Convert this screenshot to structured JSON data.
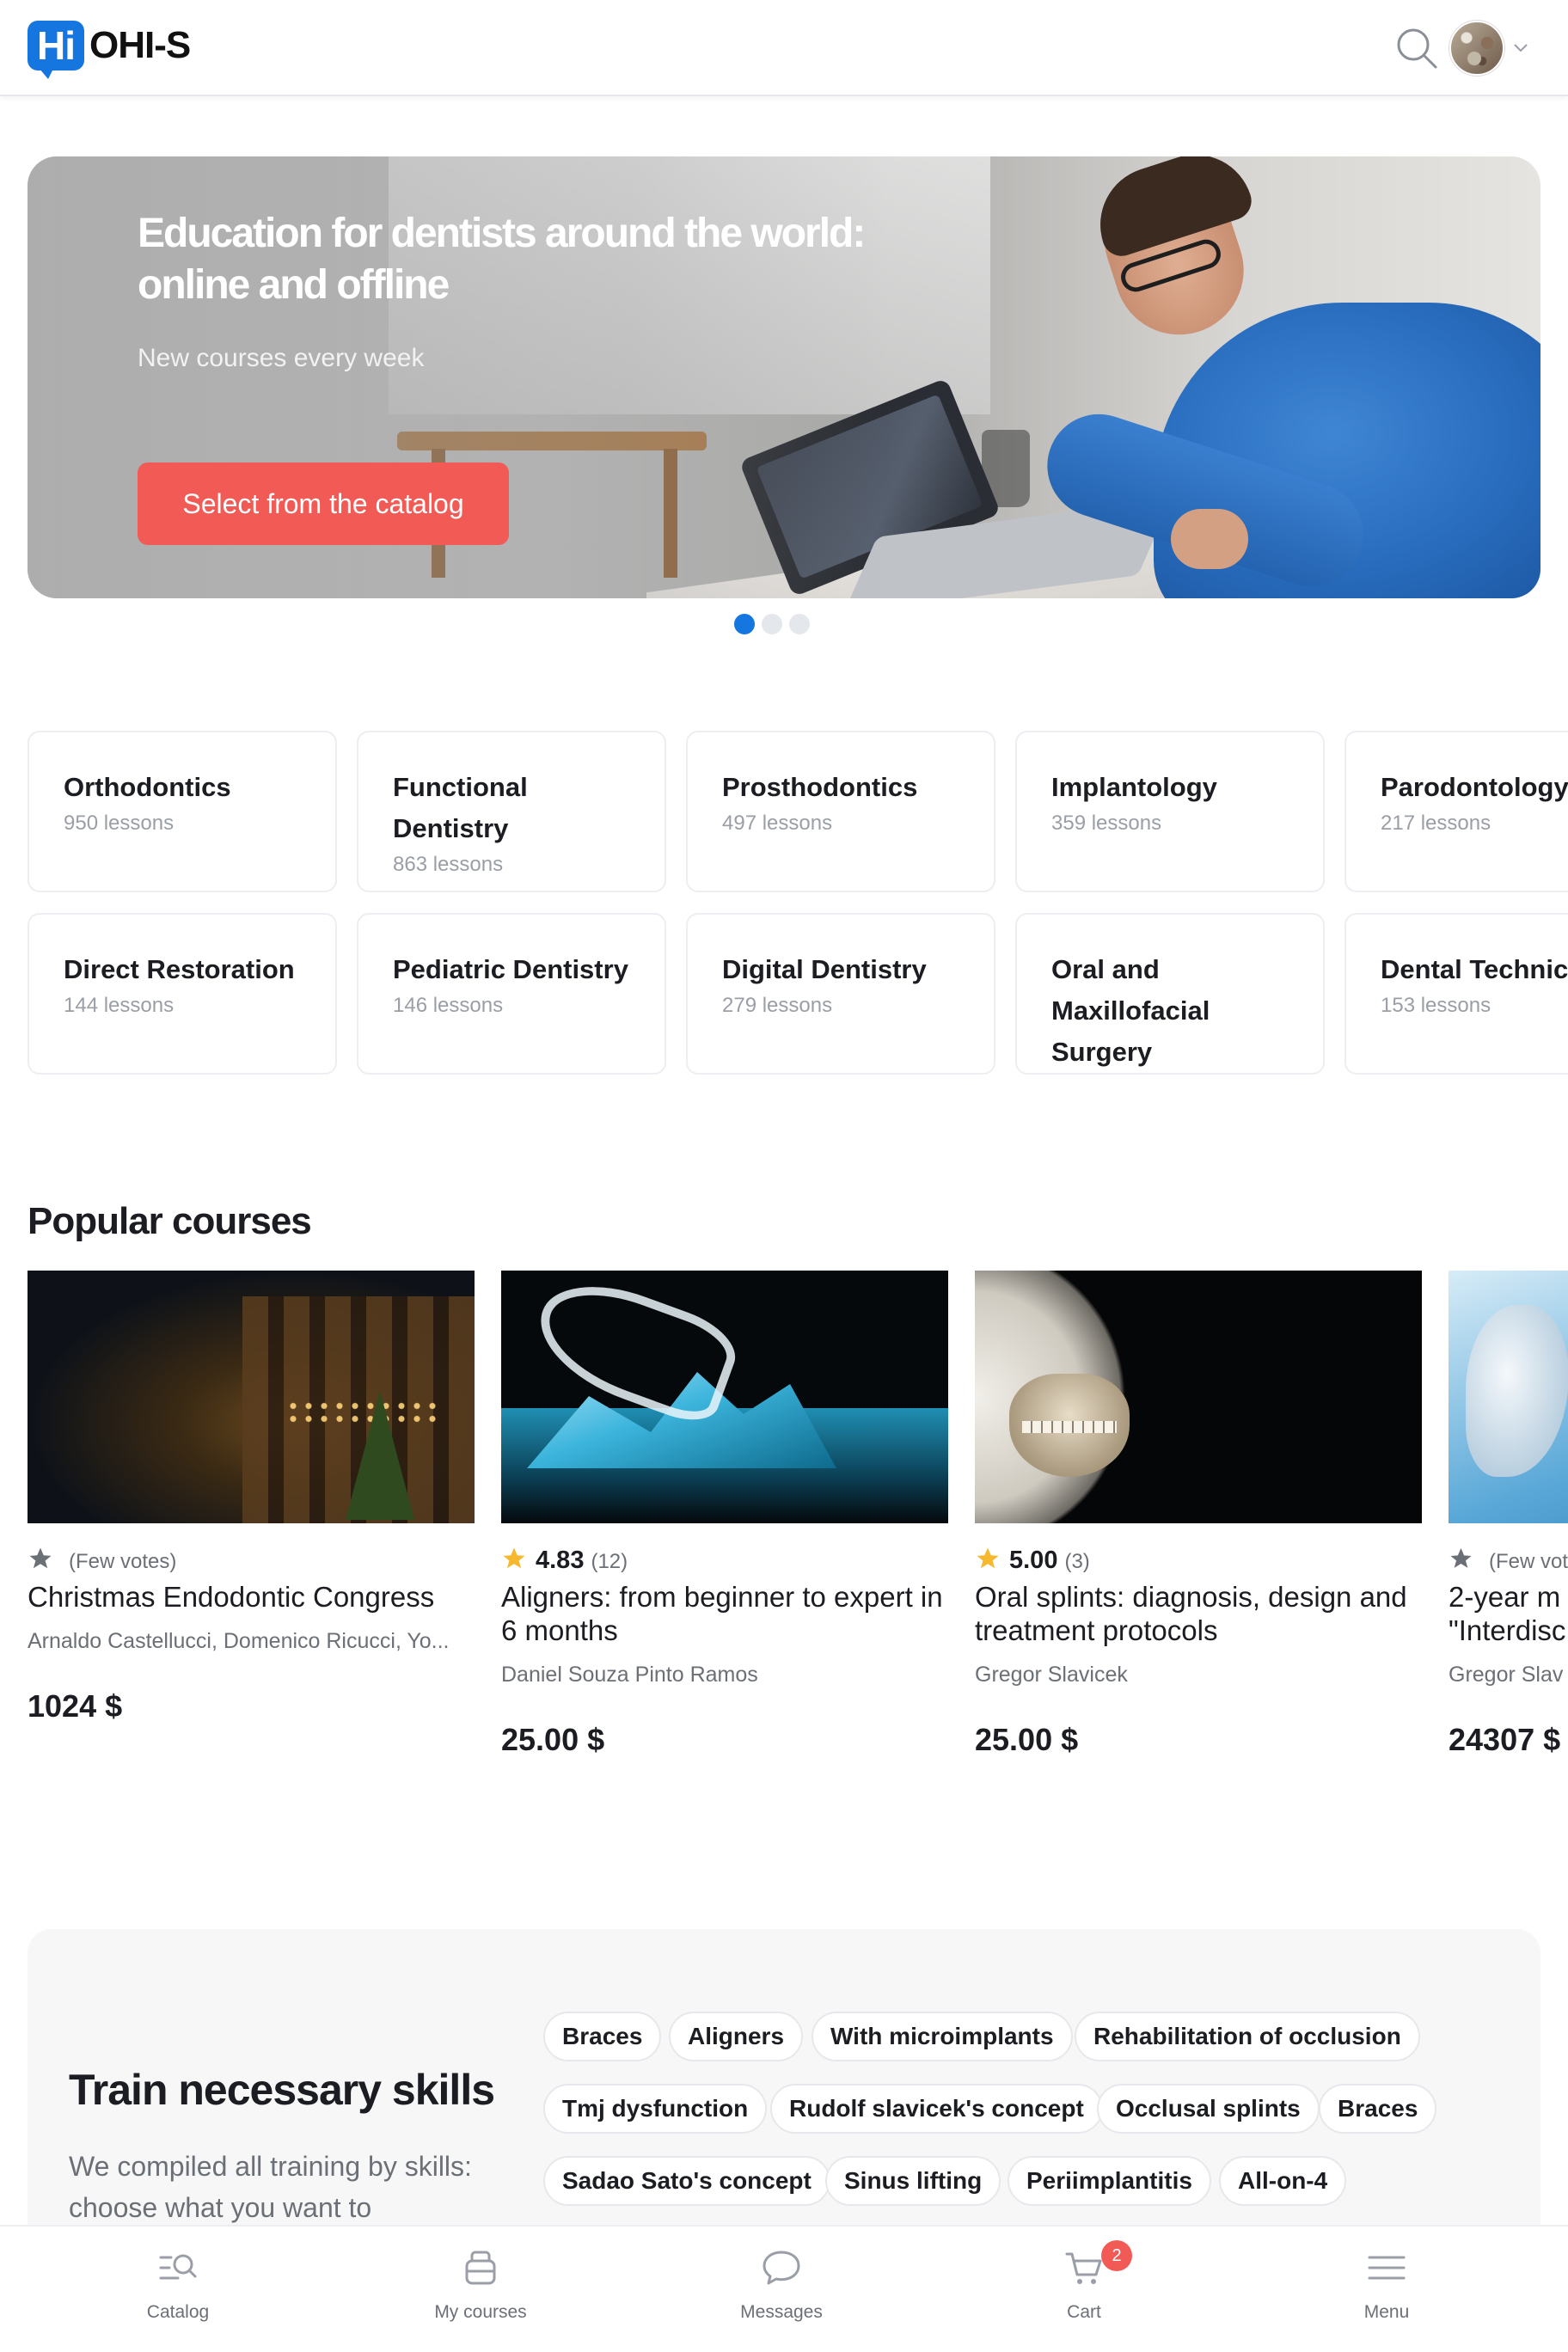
{
  "header": {
    "logo_badge": "Hi",
    "logo_text": "OHI-S",
    "search_icon": "search-icon",
    "avatar": "user-avatar",
    "dropdown_icon": "chevron-down-icon"
  },
  "hero": {
    "title": "Education for dentists around the world: online and offline",
    "subtitle": "New courses every week",
    "cta_label": "Select from the catalog",
    "cta_color": "#f15a55",
    "slides_total": 3,
    "active_slide": 1
  },
  "categories": [
    {
      "title": "Orthodontics",
      "lessons": "950 lessons"
    },
    {
      "title": "Functional Dentistry",
      "lessons": "863 lessons"
    },
    {
      "title": "Prosthodontics",
      "lessons": "497 lessons"
    },
    {
      "title": "Implantology",
      "lessons": "359 lessons"
    },
    {
      "title": "Parodontology",
      "lessons": "217 lessons"
    },
    {
      "title": "Direct Restoration",
      "lessons": "144 lessons"
    },
    {
      "title": "Pediatric Dentistry",
      "lessons": "146 lessons"
    },
    {
      "title": "Digital Dentistry",
      "lessons": "279 lessons"
    },
    {
      "title": "Oral and Maxillofacial Surgery",
      "lessons": ""
    },
    {
      "title": "Dental Technic",
      "lessons": "153 lessons"
    }
  ],
  "popular": {
    "title": "Popular courses",
    "courses": [
      {
        "rating_text": "(Few votes)",
        "score": "",
        "title": "Christmas Endodontic Congress",
        "author": "Arnaldo Castellucci, Domenico Ricucci, Yo...",
        "price": "1024 $",
        "star_color": "#6b6f76"
      },
      {
        "rating_text": "(12)",
        "score": "4.83",
        "title": "Aligners: from beginner to expert in 6 months",
        "author": "Daniel Souza Pinto Ramos",
        "price": "25.00 $",
        "star_color": "#f5b82e"
      },
      {
        "rating_text": "(3)",
        "score": "5.00",
        "title": "Oral splints: diagnosis, design and treatment protocols",
        "author": "Gregor Slavicek",
        "price": "25.00 $",
        "star_color": "#f5b82e"
      },
      {
        "rating_text": "(Few vot",
        "score": "",
        "title": "2-year m \"Interdisc",
        "author": "Gregor Slav",
        "price": "24307 $",
        "star_color": "#6b6f76"
      }
    ]
  },
  "skills": {
    "title": "Train necessary skills",
    "description": "We compiled all training by skills: choose what you want to",
    "tags": [
      "Braces",
      "Aligners",
      "With microimplants",
      "Rehabilitation of occlusion",
      "Tmj dysfunction",
      "Rudolf slavicek's concept",
      "Occlusal splints",
      "Braces",
      "Sadao Sato's concept",
      "Sinus lifting",
      "Periimplantitis",
      "All-on-4"
    ]
  },
  "bottom_nav": {
    "items": [
      {
        "label": "Catalog",
        "icon": "catalog-search-icon"
      },
      {
        "label": "My courses",
        "icon": "my-courses-icon"
      },
      {
        "label": "Messages",
        "icon": "messages-icon"
      },
      {
        "label": "Cart",
        "icon": "cart-icon",
        "badge": "2"
      },
      {
        "label": "Menu",
        "icon": "menu-icon"
      }
    ]
  },
  "colors": {
    "brand": "#1676e0",
    "accent": "#f15a55",
    "star": "#f5b82e"
  }
}
